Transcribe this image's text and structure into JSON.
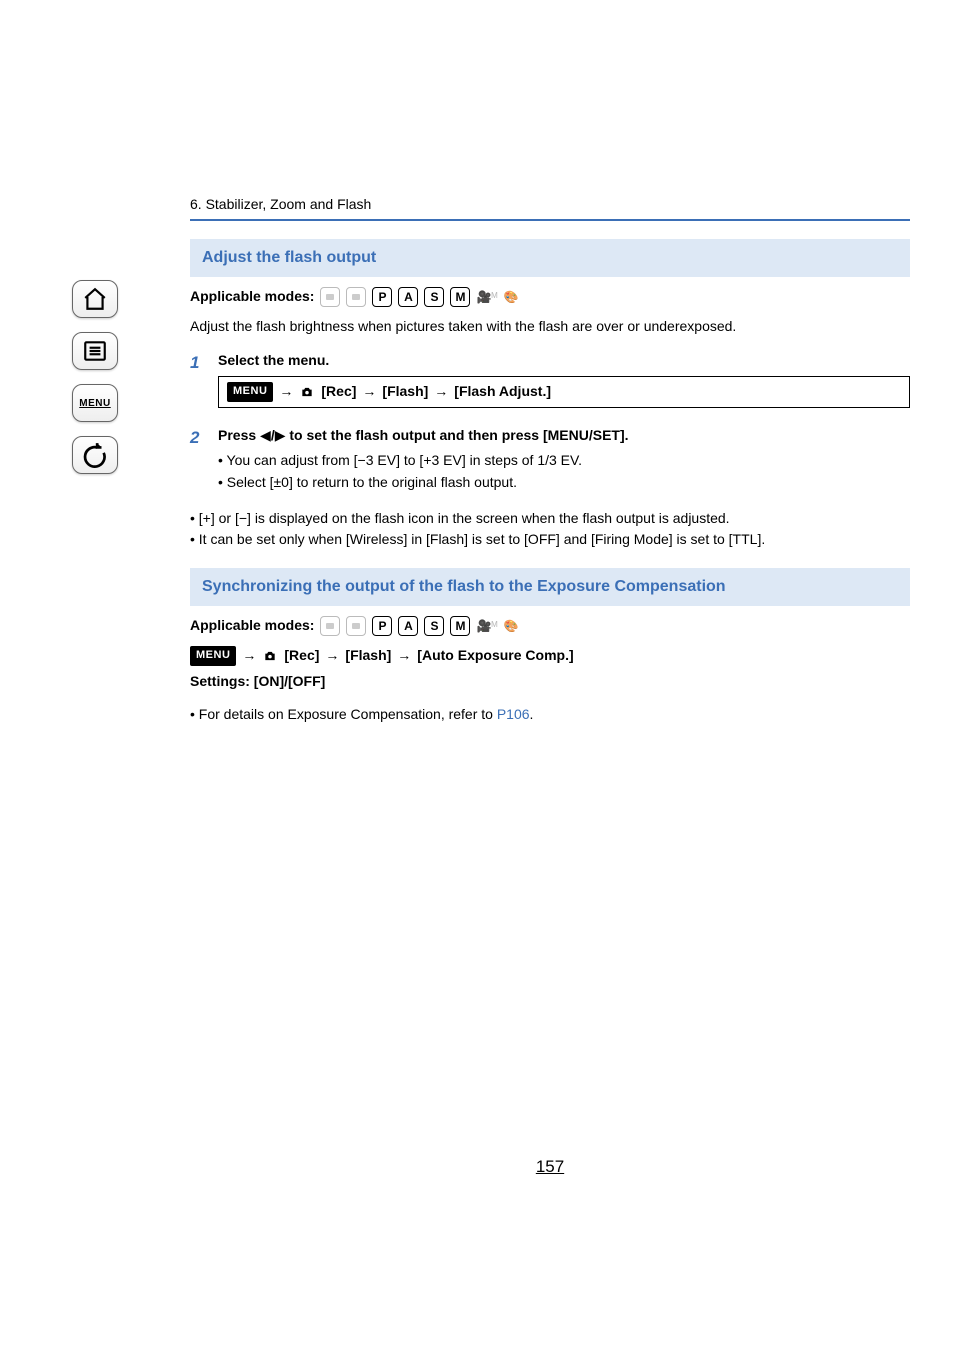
{
  "breadcrumb": "6. Stabilizer, Zoom and Flash",
  "section1": {
    "title": "Adjust the flash output",
    "modes_label": "Applicable modes:",
    "intro": "Adjust the flash brightness when pictures taken with the flash are over or underexposed.",
    "step1": {
      "num": "1",
      "title": "Select the menu.",
      "path": {
        "rec": "[Rec]",
        "flash": "[Flash]",
        "target": "[Flash Adjust.]"
      }
    },
    "step2": {
      "num": "2",
      "title_a": "Press ",
      "title_b": " to set the flash output and then press [MENU/SET].",
      "bullet1": "You can adjust from [−3 EV] to [+3 EV] in steps of 1/3 EV.",
      "bullet2": "Select [±0] to return to the original flash output."
    },
    "note1": "[+] or [−] is displayed on the flash icon in the screen when the flash output is adjusted.",
    "note2": "It can be set only when [Wireless] in [Flash] is set to [OFF] and [Firing Mode] is set to [TTL]."
  },
  "section2": {
    "title": "Synchronizing the output of the flash to the Exposure Compensation",
    "modes_label": "Applicable modes:",
    "path": {
      "rec": "[Rec]",
      "flash": "[Flash]",
      "target": "[Auto Exposure Comp.]"
    },
    "settings": "Settings: [ON]/[OFF]",
    "note_a": "For details on Exposure Compensation, refer to ",
    "note_link": "P106",
    "note_b": "."
  },
  "modes": {
    "p": "P",
    "a": "A",
    "s": "S",
    "m": "M"
  },
  "nav": {
    "menu": "MENU"
  },
  "arrow": "→",
  "tri_left": "◀",
  "tri_right": "▶",
  "page_number": "157"
}
